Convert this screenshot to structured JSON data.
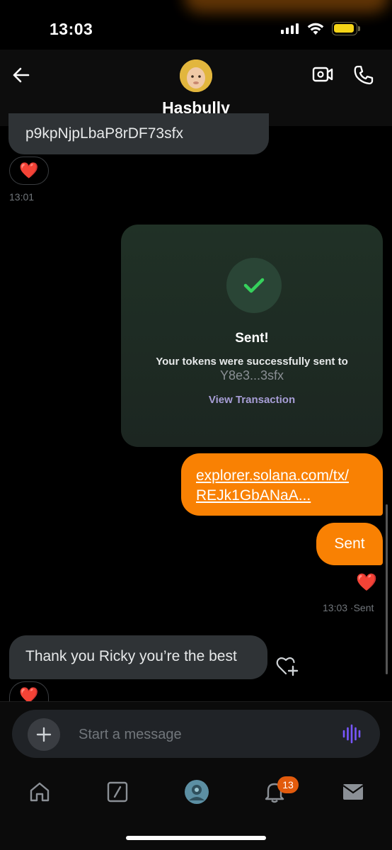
{
  "status_bar": {
    "time": "13:03",
    "battery_color": "#f5d417"
  },
  "header": {
    "contact_name": "Hasbully",
    "avatar_icon": "contact-avatar",
    "back_icon": "arrow-left-icon",
    "video_icon": "video-call-icon",
    "phone_icon": "phone-icon"
  },
  "messages": {
    "partial_text": "p9kpNjpLbaP8rDF73sfx",
    "reaction_emoji": "❤️",
    "timestamp_1": "13:01",
    "tx_card": {
      "title": "Sent!",
      "subtitle": "Your tokens were successfully sent to",
      "address": "Y8e3...3sfx",
      "link_label": "View Transaction",
      "accent_color": "#36d15c"
    },
    "link_line_1": "explorer.solana.com/tx/",
    "link_line_2": "REJk1GbANaA...",
    "sent_text": "Sent",
    "sent_reaction": "❤️",
    "timestamp_2": "13:03 ·Sent",
    "incoming_text": "Thank you Ricky you’re the best",
    "incoming_reaction": "❤️"
  },
  "composer": {
    "placeholder": "Start a message",
    "accent_color": "#7856ff"
  },
  "tabs": {
    "home_icon": "home-icon",
    "grok_icon": "grok-icon",
    "communities_icon": "communities-avatar-icon",
    "notifications_icon": "bell-icon",
    "notifications_badge": "13",
    "messages_icon": "envelope-icon"
  },
  "colors": {
    "outgoing_bubble": "#f98103",
    "incoming_bubble": "#2f3336",
    "link_purple": "#a79ed6"
  }
}
